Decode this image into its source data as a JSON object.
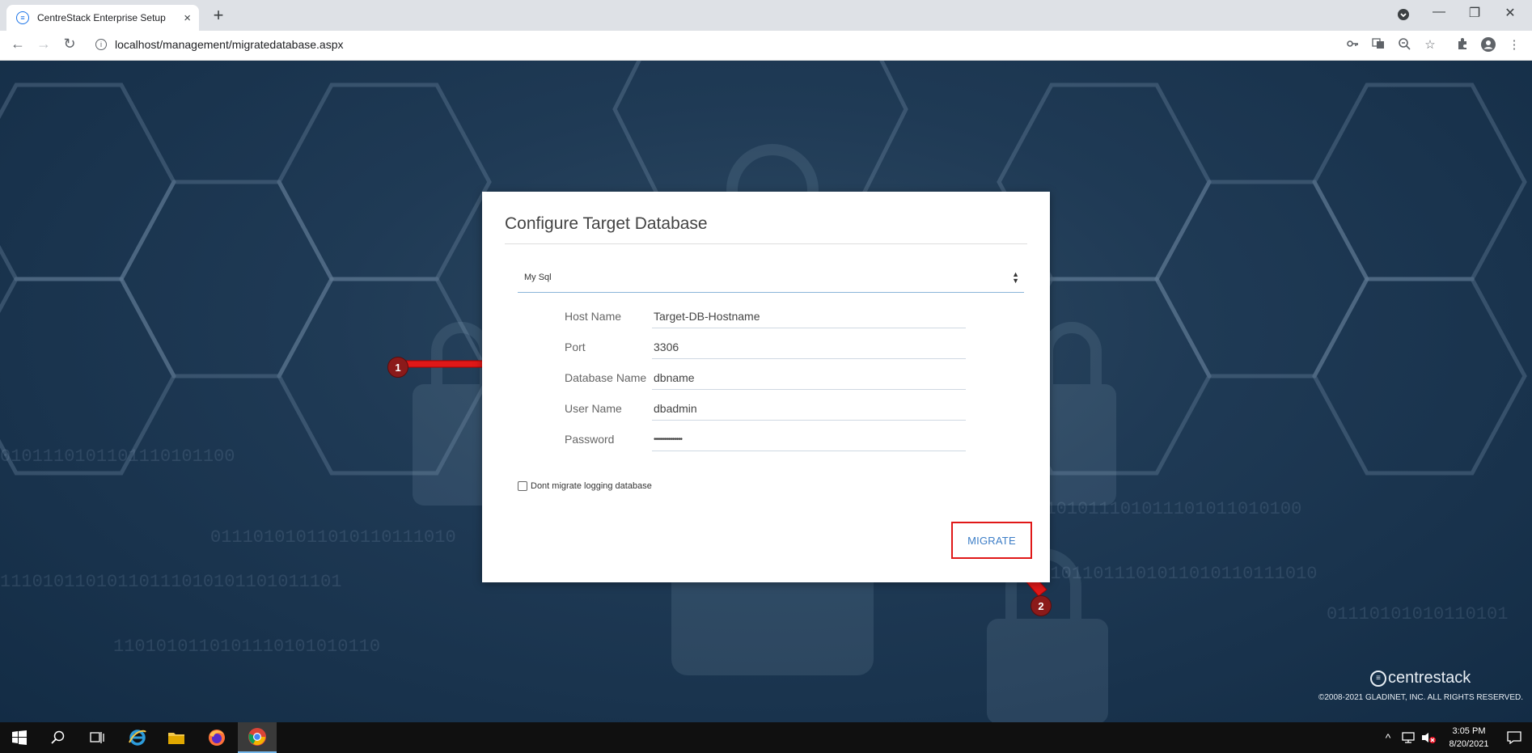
{
  "browser": {
    "tab_title": "CentreStack Enterprise Setup",
    "tab_close": "×",
    "new_tab": "+",
    "url": "localhost/management/migratedatabase.aspx",
    "window_controls": {
      "minimize": "—",
      "restore": "❐",
      "close": "✕"
    }
  },
  "dialog": {
    "title": "Configure Target Database",
    "db_type": {
      "selected": "My Sql"
    },
    "fields": [
      {
        "label": "Host Name",
        "value": "Target-DB-Hostname"
      },
      {
        "label": "Port",
        "value": "3306"
      },
      {
        "label": "Database Name",
        "value": "dbname"
      },
      {
        "label": "User Name",
        "value": "dbadmin"
      },
      {
        "label": "Password",
        "value": "••••••••••••••"
      }
    ],
    "checkbox_label": "Dont migrate logging database",
    "migrate_label": "MIGRATE"
  },
  "annotations": {
    "step1": "1",
    "step2": "2",
    "arrow_color": "#e01818",
    "badge_color": "#8b1a1a"
  },
  "footer": {
    "brand": "centrestack",
    "copyright": "©2008-2021 GLADINET, INC. ALL RIGHTS RESERVED."
  },
  "taskbar": {
    "time": "3:05 PM",
    "date": "8/20/2021"
  },
  "colors": {
    "accent": "#3d7ec7",
    "highlight": "#e01818",
    "page_bg": "#1f3a55"
  }
}
